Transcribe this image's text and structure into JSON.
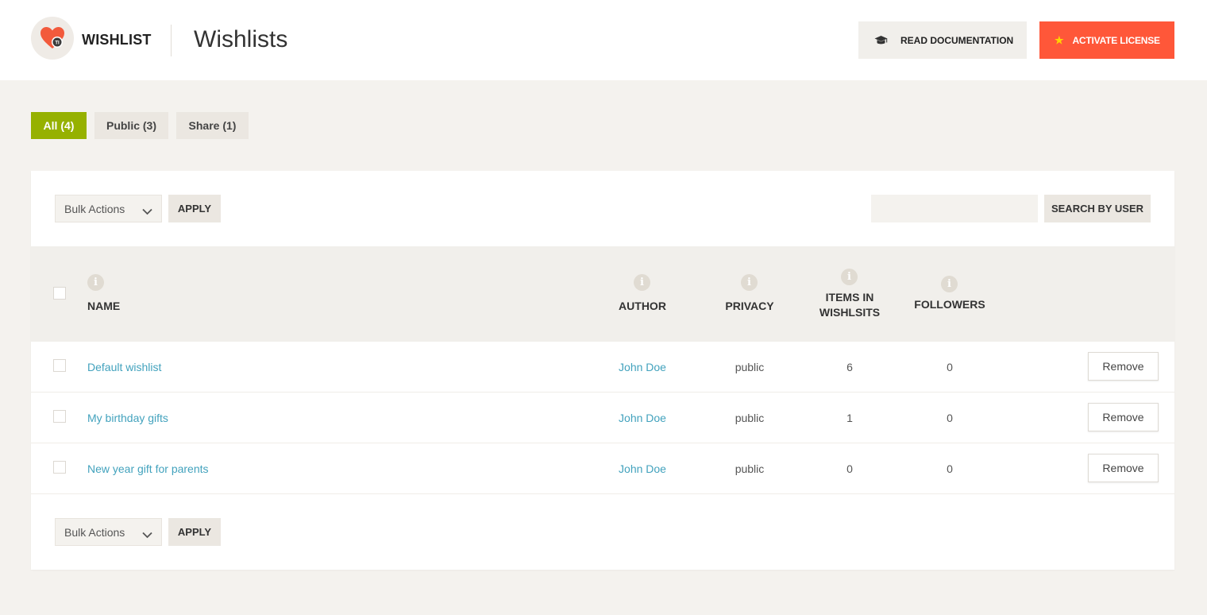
{
  "header": {
    "brand": "WISHLIST",
    "page_title": "Wishlists",
    "docs_button": "READ DOCUMENTATION",
    "license_button": "ACTIVATE LICENSE",
    "accent_color": "#ff5739"
  },
  "filters": [
    {
      "label": "All (4)",
      "active": true
    },
    {
      "label": "Public (3)",
      "active": false
    },
    {
      "label": "Share (1)",
      "active": false
    }
  ],
  "toolbar": {
    "bulk_actions": "Bulk Actions",
    "apply": "APPLY",
    "search_value": "",
    "search_button": "SEARCH BY USER"
  },
  "table": {
    "columns": {
      "name": "NAME",
      "author": "AUTHOR",
      "privacy": "PRIVACY",
      "items_line1": "ITEMS IN",
      "items_line2": "WISHLSITS",
      "followers": "FOLLOWERS"
    },
    "rows": [
      {
        "name": "Default wishlist",
        "author": "John Doe",
        "privacy": "public",
        "items": "6",
        "followers": "0",
        "action": "Remove"
      },
      {
        "name": "My birthday gifts",
        "author": "John Doe",
        "privacy": "public",
        "items": "1",
        "followers": "0",
        "action": "Remove"
      },
      {
        "name": "New year gift for parents",
        "author": "John Doe",
        "privacy": "public",
        "items": "0",
        "followers": "0",
        "action": "Remove"
      }
    ]
  },
  "icons": {
    "logo": "heart-logo-icon",
    "docs": "graduation-cap-icon",
    "license": "star-icon",
    "column_info": "info-icon",
    "select": "chevron-down-icon"
  }
}
